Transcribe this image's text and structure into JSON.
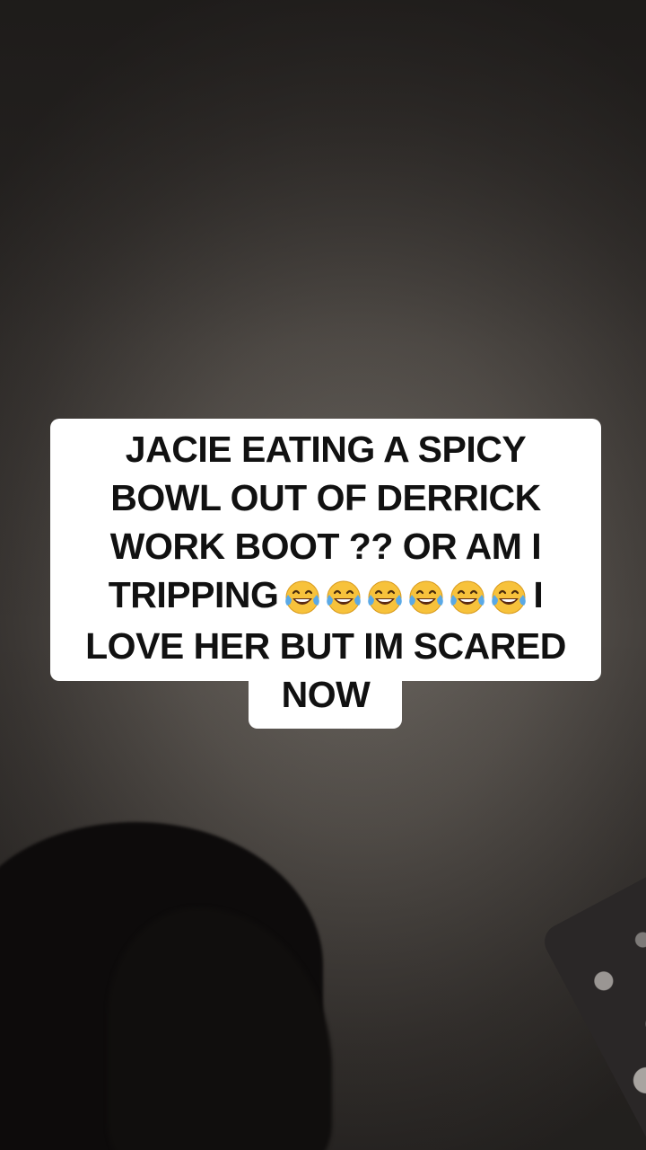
{
  "caption": {
    "line1": "JACIE EATING A SPICY",
    "line2": "BOWL OUT OF DERRICK",
    "line3": "WORK BOOT ?? OR AM I",
    "line4_start": "TRIPPING",
    "line4_end": "I",
    "line5": "LOVE HER BUT IM SCARED",
    "line6": "NOW",
    "emoji_name": "face-with-tears-of-joy-icon",
    "emoji_count": 6
  },
  "colors": {
    "caption_bg": "#ffffff",
    "caption_text": "#111111",
    "emoji_face": "#f7c23b",
    "emoji_tears": "#5aa9e6"
  }
}
